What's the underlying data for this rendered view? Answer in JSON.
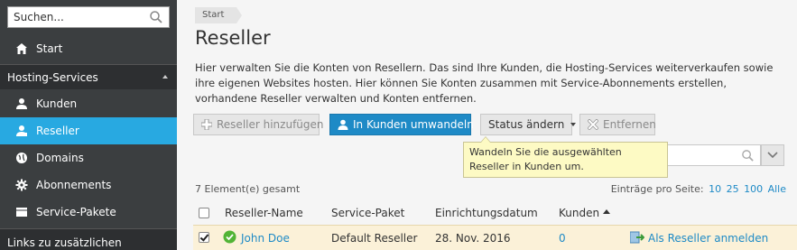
{
  "sidebar": {
    "search": {
      "placeholder": "Suchen..."
    },
    "start_label": "Start",
    "group_hosting": "Hosting-Services",
    "items": [
      {
        "label": "Kunden",
        "icon": "user-icon"
      },
      {
        "label": "Reseller",
        "icon": "reseller-icon"
      },
      {
        "label": "Domains",
        "icon": "globe-icon"
      },
      {
        "label": "Abonnements",
        "icon": "gear-icon"
      },
      {
        "label": "Service-Pakete",
        "icon": "package-icon"
      }
    ],
    "group_links": "Links zu zusätzlichen"
  },
  "breadcrumb": "Start",
  "page": {
    "title": "Reseller",
    "intro": "Hier verwalten Sie die Konten von Resellern. Das sind Ihre Kunden, die Hosting-Services weiterverkaufen sowie ihre eigenen Websites hosten. Hier können Sie Konten zusammen mit Service-Abonnements erstellen, vorhandene Reseller verwalten und Konten entfernen."
  },
  "toolbar": {
    "add_label": "Reseller hinzufügen",
    "convert_label": "In Kunden umwandeln",
    "status_label": "Status ändern",
    "remove_label": "Entfernen"
  },
  "tooltip": "Wandeln Sie die ausgewählten Reseller in Kunden um.",
  "list": {
    "total": "7 Element(e) gesamt",
    "per_page_label": "Einträge pro Seite:",
    "per_page_options": [
      "10",
      "25",
      "100",
      "Alle"
    ],
    "columns": [
      "Reseller-Name",
      "Service-Paket",
      "Einrichtungsdatum",
      "Kunden"
    ],
    "rows": [
      {
        "name": "John Doe",
        "package": "Default Reseller",
        "date": "28. Nov. 2016",
        "customers": "0",
        "action": "Als Reseller anmelden",
        "checked": true
      }
    ]
  },
  "colors": {
    "sidebar_bg": "#3b3e40",
    "active_nav": "#28a9e1",
    "primary_button": "#1e8ac6",
    "tooltip_bg": "#fdfac4",
    "selected_row": "#fbf1d8"
  }
}
